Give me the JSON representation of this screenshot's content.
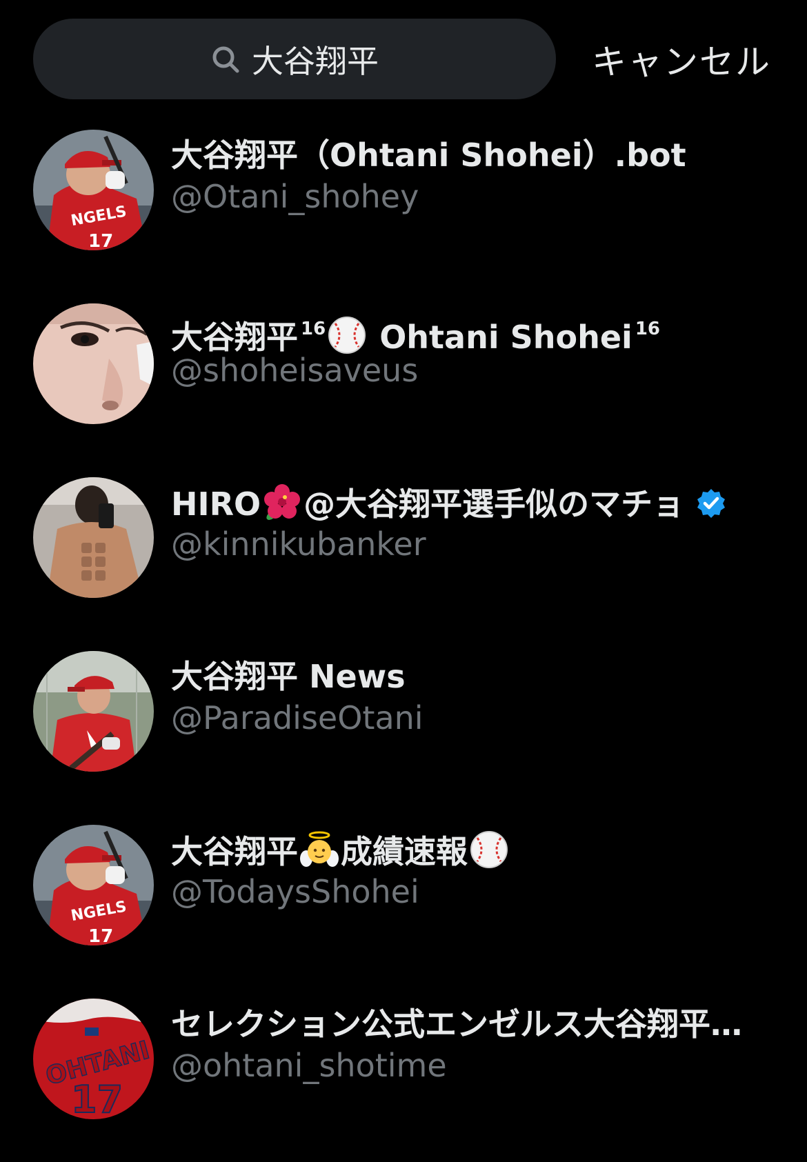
{
  "search": {
    "query": "大谷翔平",
    "cancel_label": "キャンセル"
  },
  "results": [
    {
      "name": "大谷翔平（Ohtani Shohei）.bot",
      "handle": "@Otani_shohey",
      "avatar": "player-batting-red-uniform"
    },
    {
      "name_part1": "大谷翔平",
      "sup1": "16",
      "emoji1": "baseball",
      "name_part2": "Ohtani Shohei",
      "sup2": "16",
      "handle": "@shoheisaveus",
      "avatar": "face-closeup"
    },
    {
      "name_part1": "HIRO",
      "emoji1": "hibiscus",
      "name_part2": "@大谷翔平選手似のマチョ",
      "verified": true,
      "handle": "@kinnikubanker",
      "avatar": "muscle-selfie"
    },
    {
      "name": "大谷翔平 News",
      "handle": "@ParadiseOtani",
      "avatar": "player-red-jersey-bat"
    },
    {
      "name_part1": "大谷翔平",
      "emoji1": "baby-angel",
      "name_part2": "成績速報",
      "emoji2": "baseball",
      "handle": "@TodaysShohei",
      "avatar": "player-batting-red-uniform"
    },
    {
      "name": "セレクション公式エンゼルス大谷翔平…",
      "handle": "@ohtani_shotime",
      "avatar": "ohtani-17-jersey"
    }
  ],
  "colors": {
    "background": "#000000",
    "search_bg": "#202327",
    "primary_text": "#e7e9ea",
    "secondary_text": "#71767b",
    "verified_blue": "#1d9bf0"
  }
}
